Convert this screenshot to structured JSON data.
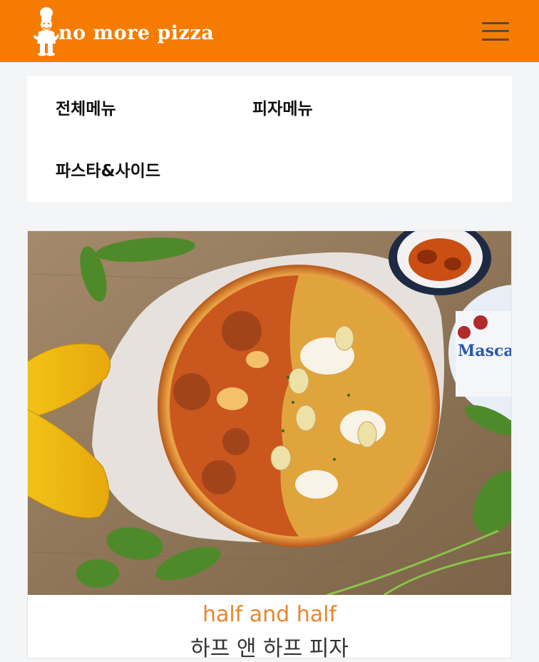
{
  "header": {
    "brand_text": "no more pizza",
    "mascot_icon": "chef-mascot-icon",
    "menu_icon": "hamburger-menu-icon",
    "accent": "#f57c00"
  },
  "categories": [
    {
      "label": "전체메뉴"
    },
    {
      "label": "피자메뉴"
    },
    {
      "label": "파스타&사이드"
    }
  ],
  "product": {
    "name_en": "half and half",
    "name_kr": "하프 앤 하프 피자",
    "image_alt": "pizza-photo",
    "tub_label": "Masca"
  }
}
